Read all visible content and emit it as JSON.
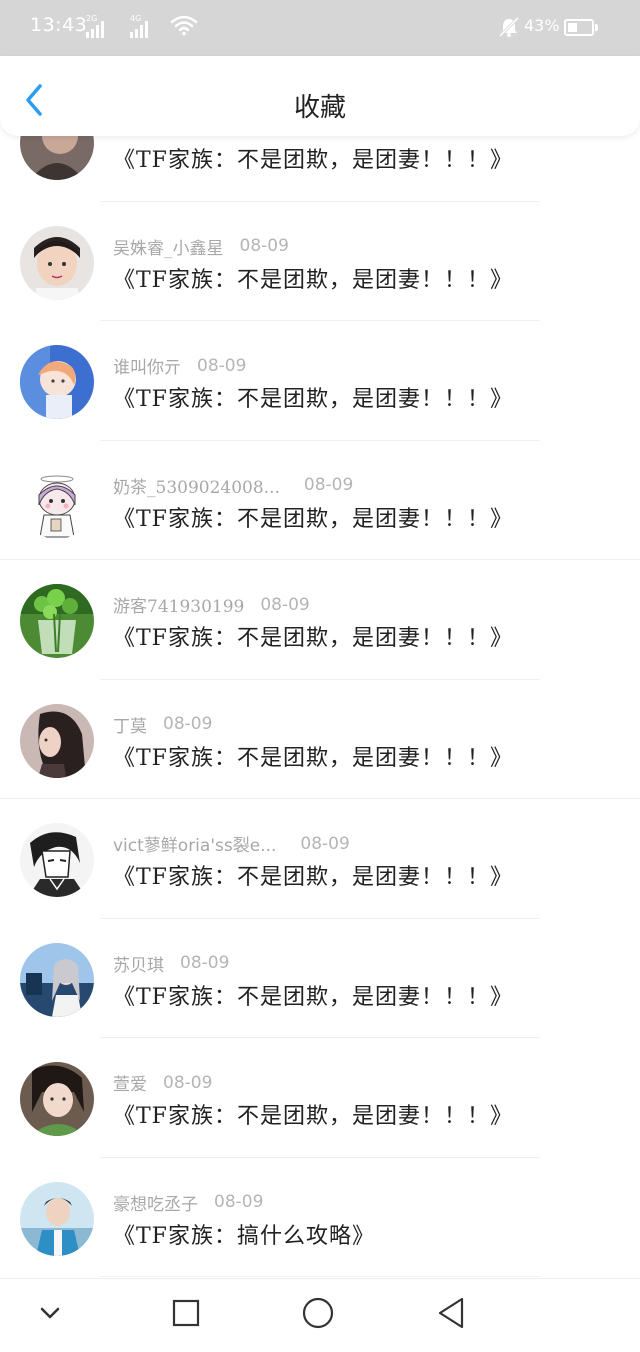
{
  "status_bar": {
    "time": "13:43",
    "sim1_tag": "2G",
    "sim2_tag": "4G",
    "battery_percent": "43%",
    "battery_level": 0.43,
    "icons": [
      "signal-icon",
      "wifi-icon",
      "mute-bell-icon",
      "battery-icon"
    ]
  },
  "header": {
    "title": "收藏",
    "back_icon": "chevron-left-icon",
    "back_color": "#2a9df4"
  },
  "favorites": [
    {
      "user": "",
      "date": "",
      "text": "《TF家族：不是团欺，是团妻！！！》",
      "avatar": "partial"
    },
    {
      "user": "吴姝睿_小鑫星",
      "date": "08-09",
      "text": "《TF家族：不是团欺，是团妻！！！》",
      "avatar": "boy-photo"
    },
    {
      "user": "谁叫你亓",
      "date": "08-09",
      "text": "《TF家族：不是团欺，是团妻！！！》",
      "avatar": "anime-blue"
    },
    {
      "user": "奶茶_5309024008...",
      "date": "08-09",
      "text": "《TF家族：不是团欺，是团妻！！！》",
      "avatar": "cartoon-girl"
    },
    {
      "user": "游客741930199",
      "date": "08-09",
      "text": "《TF家族：不是团欺，是团妻！！！》",
      "avatar": "clover-glass"
    },
    {
      "user": "丁莫",
      "date": "08-09",
      "text": "《TF家族：不是团欺，是团妻！！！》",
      "avatar": "dark-hair-girl"
    },
    {
      "user": "vict蓼鲜oria'ss裂e...",
      "date": "08-09",
      "text": "《TF家族：不是团欺，是团妻！！！》",
      "avatar": "manga-bw"
    },
    {
      "user": "苏贝琪",
      "date": "08-09",
      "text": "《TF家族：不是团欺，是团妻！！！》",
      "avatar": "blue-scene"
    },
    {
      "user": "萱爱",
      "date": "08-09",
      "text": "《TF家族：不是团欺，是团妻！！！》",
      "avatar": "girl-green"
    },
    {
      "user": "豪想吃丞子",
      "date": "08-09",
      "text": "《TF家族：搞什么攻略》",
      "avatar": "boy-blue-jacket"
    }
  ],
  "nav_bar": {
    "buttons": [
      "collapse-chevron-icon",
      "recents-square-icon",
      "home-circle-icon",
      "back-triangle-icon"
    ]
  },
  "colors": {
    "accent": "#2a9df4",
    "status_bar_bg": "#d6d6d6",
    "meta_text": "#a8a8a8",
    "body_text": "#222222"
  }
}
